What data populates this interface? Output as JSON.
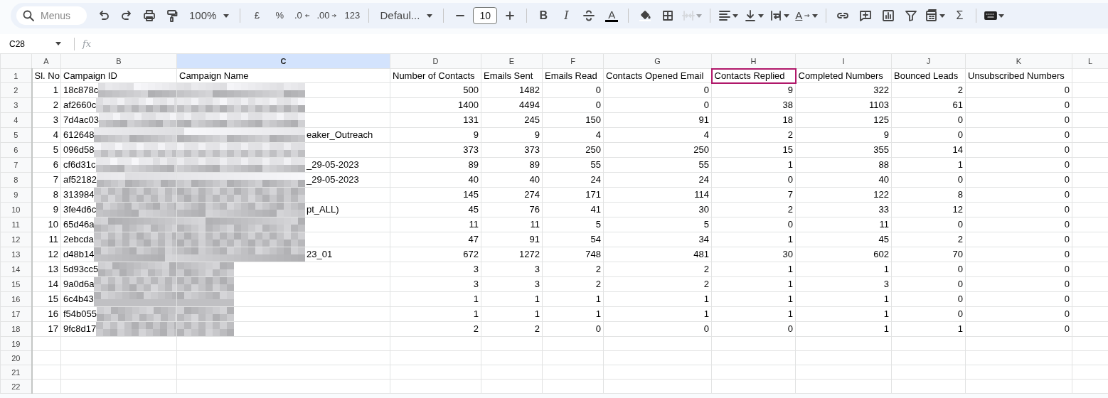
{
  "toolbar": [
    {
      "kind": "search",
      "placeholder": "Menus"
    },
    {
      "kind": "icon",
      "disabled": false
    },
    {
      "kind": "icon",
      "disabled": false
    },
    {
      "kind": "icon",
      "disabled": false
    },
    {
      "kind": "icon",
      "disabled": false
    },
    {
      "kind": "dropdown",
      "label": "100%"
    },
    {
      "kind": "sep"
    },
    {
      "kind": "text",
      "label": "£"
    },
    {
      "kind": "text",
      "label": "%"
    },
    {
      "kind": "lessdecimal",
      "label": ".0"
    },
    {
      "kind": "moredecimal",
      "label": ".00"
    },
    {
      "kind": "text",
      "label": "123"
    },
    {
      "kind": "sep"
    },
    {
      "kind": "dropdown",
      "label": "Defaul..."
    },
    {
      "kind": "sep"
    },
    {
      "kind": "icon",
      "disabled": false
    },
    {
      "kind": "field",
      "value": "10"
    },
    {
      "kind": "icon",
      "disabled": false
    },
    {
      "kind": "sep"
    },
    {
      "kind": "bold",
      "label": "B"
    },
    {
      "kind": "italic",
      "label": "I"
    },
    {
      "kind": "icon",
      "disabled": false
    },
    {
      "kind": "textcolor",
      "label": "A"
    },
    {
      "kind": "sep"
    },
    {
      "kind": "icon",
      "disabled": false
    },
    {
      "kind": "icon",
      "disabled": false
    },
    {
      "kind": "icon",
      "disabled": true
    },
    {
      "kind": "sep"
    },
    {
      "kind": "icon",
      "disabled": false
    },
    {
      "kind": "icon",
      "disabled": false
    },
    {
      "kind": "icon",
      "disabled": false
    },
    {
      "kind": "rotate",
      "label": "A"
    },
    {
      "kind": "sep"
    },
    {
      "kind": "icon",
      "disabled": false
    },
    {
      "kind": "icon",
      "disabled": false
    },
    {
      "kind": "icon",
      "disabled": false
    },
    {
      "kind": "icon",
      "disabled": false
    },
    {
      "kind": "icon",
      "disabled": false
    },
    {
      "kind": "text",
      "label": "Σ"
    },
    {
      "kind": "sep"
    },
    {
      "kind": "icon",
      "disabled": false
    }
  ],
  "formula_bar": {
    "name_box": "C28",
    "fx": "fx"
  },
  "columns": [
    {
      "letter": "A",
      "selected": false
    },
    {
      "letter": "B",
      "selected": false
    },
    {
      "letter": "C",
      "selected": true
    },
    {
      "letter": "D",
      "selected": false
    },
    {
      "letter": "E",
      "selected": false
    },
    {
      "letter": "F",
      "selected": false
    },
    {
      "letter": "G",
      "selected": false
    },
    {
      "letter": "H",
      "selected": false
    },
    {
      "letter": "I",
      "selected": false
    },
    {
      "letter": "J",
      "selected": false
    },
    {
      "letter": "K",
      "selected": false
    },
    {
      "letter": "L",
      "selected": false
    }
  ],
  "header_row": {
    "number": "1",
    "cells": [
      {
        "text": "Sl. No",
        "selected": false
      },
      {
        "text": "Campaign ID",
        "selected": false
      },
      {
        "text": "Campaign Name",
        "selected": false
      },
      {
        "text": "Number of Contacts",
        "selected": false
      },
      {
        "text": "Emails Sent",
        "selected": false
      },
      {
        "text": "Emails Read",
        "selected": false
      },
      {
        "text": "Contacts Opened Email",
        "selected": false
      },
      {
        "text": "Contacts Replied",
        "selected": true
      },
      {
        "text": "Completed Numbers",
        "selected": false
      },
      {
        "text": "Bounced Leads",
        "selected": false
      },
      {
        "text": "Unsubscribed Numbers",
        "selected": false
      }
    ]
  },
  "rows": [
    {
      "number": "2",
      "cells": [
        "1",
        "18c878c",
        "",
        "500",
        "1482",
        "0",
        "0",
        "9",
        "322",
        "2",
        "0"
      ]
    },
    {
      "number": "3",
      "cells": [
        "2",
        "af2660c",
        "",
        "1400",
        "4494",
        "0",
        "0",
        "38",
        "1103",
        "61",
        "0"
      ]
    },
    {
      "number": "4",
      "cells": [
        "3",
        "7d4ac03",
        "",
        "131",
        "245",
        "150",
        "91",
        "18",
        "125",
        "0",
        "0"
      ]
    },
    {
      "number": "5",
      "cells": [
        "4",
        "612648",
        "eaker_Outreach",
        "9",
        "9",
        "4",
        "4",
        "2",
        "9",
        "0",
        "0"
      ]
    },
    {
      "number": "6",
      "cells": [
        "5",
        "096d58",
        "",
        "373",
        "373",
        "250",
        "250",
        "15",
        "355",
        "14",
        "0"
      ]
    },
    {
      "number": "7",
      "cells": [
        "6",
        "cf6d31c",
        "_29-05-2023",
        "89",
        "89",
        "55",
        "55",
        "1",
        "88",
        "1",
        "0"
      ]
    },
    {
      "number": "8",
      "cells": [
        "7",
        "af52182",
        "_29-05-2023",
        "40",
        "40",
        "24",
        "24",
        "0",
        "40",
        "0",
        "0"
      ]
    },
    {
      "number": "9",
      "cells": [
        "8",
        "313984",
        "",
        "145",
        "274",
        "171",
        "114",
        "7",
        "122",
        "8",
        "0"
      ]
    },
    {
      "number": "10",
      "cells": [
        "9",
        "3fe4d6c",
        "pt_ALL)",
        "45",
        "76",
        "41",
        "30",
        "2",
        "33",
        "12",
        "0"
      ]
    },
    {
      "number": "11",
      "cells": [
        "10",
        "65d46a",
        "",
        "11",
        "11",
        "5",
        "5",
        "0",
        "11",
        "0",
        "0"
      ]
    },
    {
      "number": "12",
      "cells": [
        "11",
        "2ebcda",
        "",
        "47",
        "91",
        "54",
        "34",
        "1",
        "45",
        "2",
        "0"
      ]
    },
    {
      "number": "13",
      "cells": [
        "12",
        "d48b14",
        "23_01",
        "672",
        "1272",
        "748",
        "481",
        "30",
        "602",
        "70",
        "0"
      ]
    },
    {
      "number": "14",
      "cells": [
        "13",
        "5d93cc5",
        "",
        "3",
        "3",
        "2",
        "2",
        "1",
        "1",
        "0",
        "0"
      ]
    },
    {
      "number": "15",
      "cells": [
        "14",
        "9a0d6a",
        "",
        "3",
        "3",
        "2",
        "2",
        "1",
        "3",
        "0",
        "0"
      ]
    },
    {
      "number": "16",
      "cells": [
        "15",
        "6c4b43",
        "",
        "1",
        "1",
        "1",
        "1",
        "1",
        "1",
        "0",
        "0"
      ]
    },
    {
      "number": "17",
      "cells": [
        "16",
        "f54b055",
        "",
        "1",
        "1",
        "1",
        "1",
        "1",
        "1",
        "0",
        "0"
      ]
    },
    {
      "number": "18",
      "cells": [
        "17",
        "9fc8d17",
        "",
        "2",
        "2",
        "0",
        "0",
        "0",
        "1",
        "1",
        "0"
      ]
    },
    {
      "number": "19"
    },
    {
      "number": "20"
    },
    {
      "number": "21"
    },
    {
      "number": "22"
    }
  ]
}
